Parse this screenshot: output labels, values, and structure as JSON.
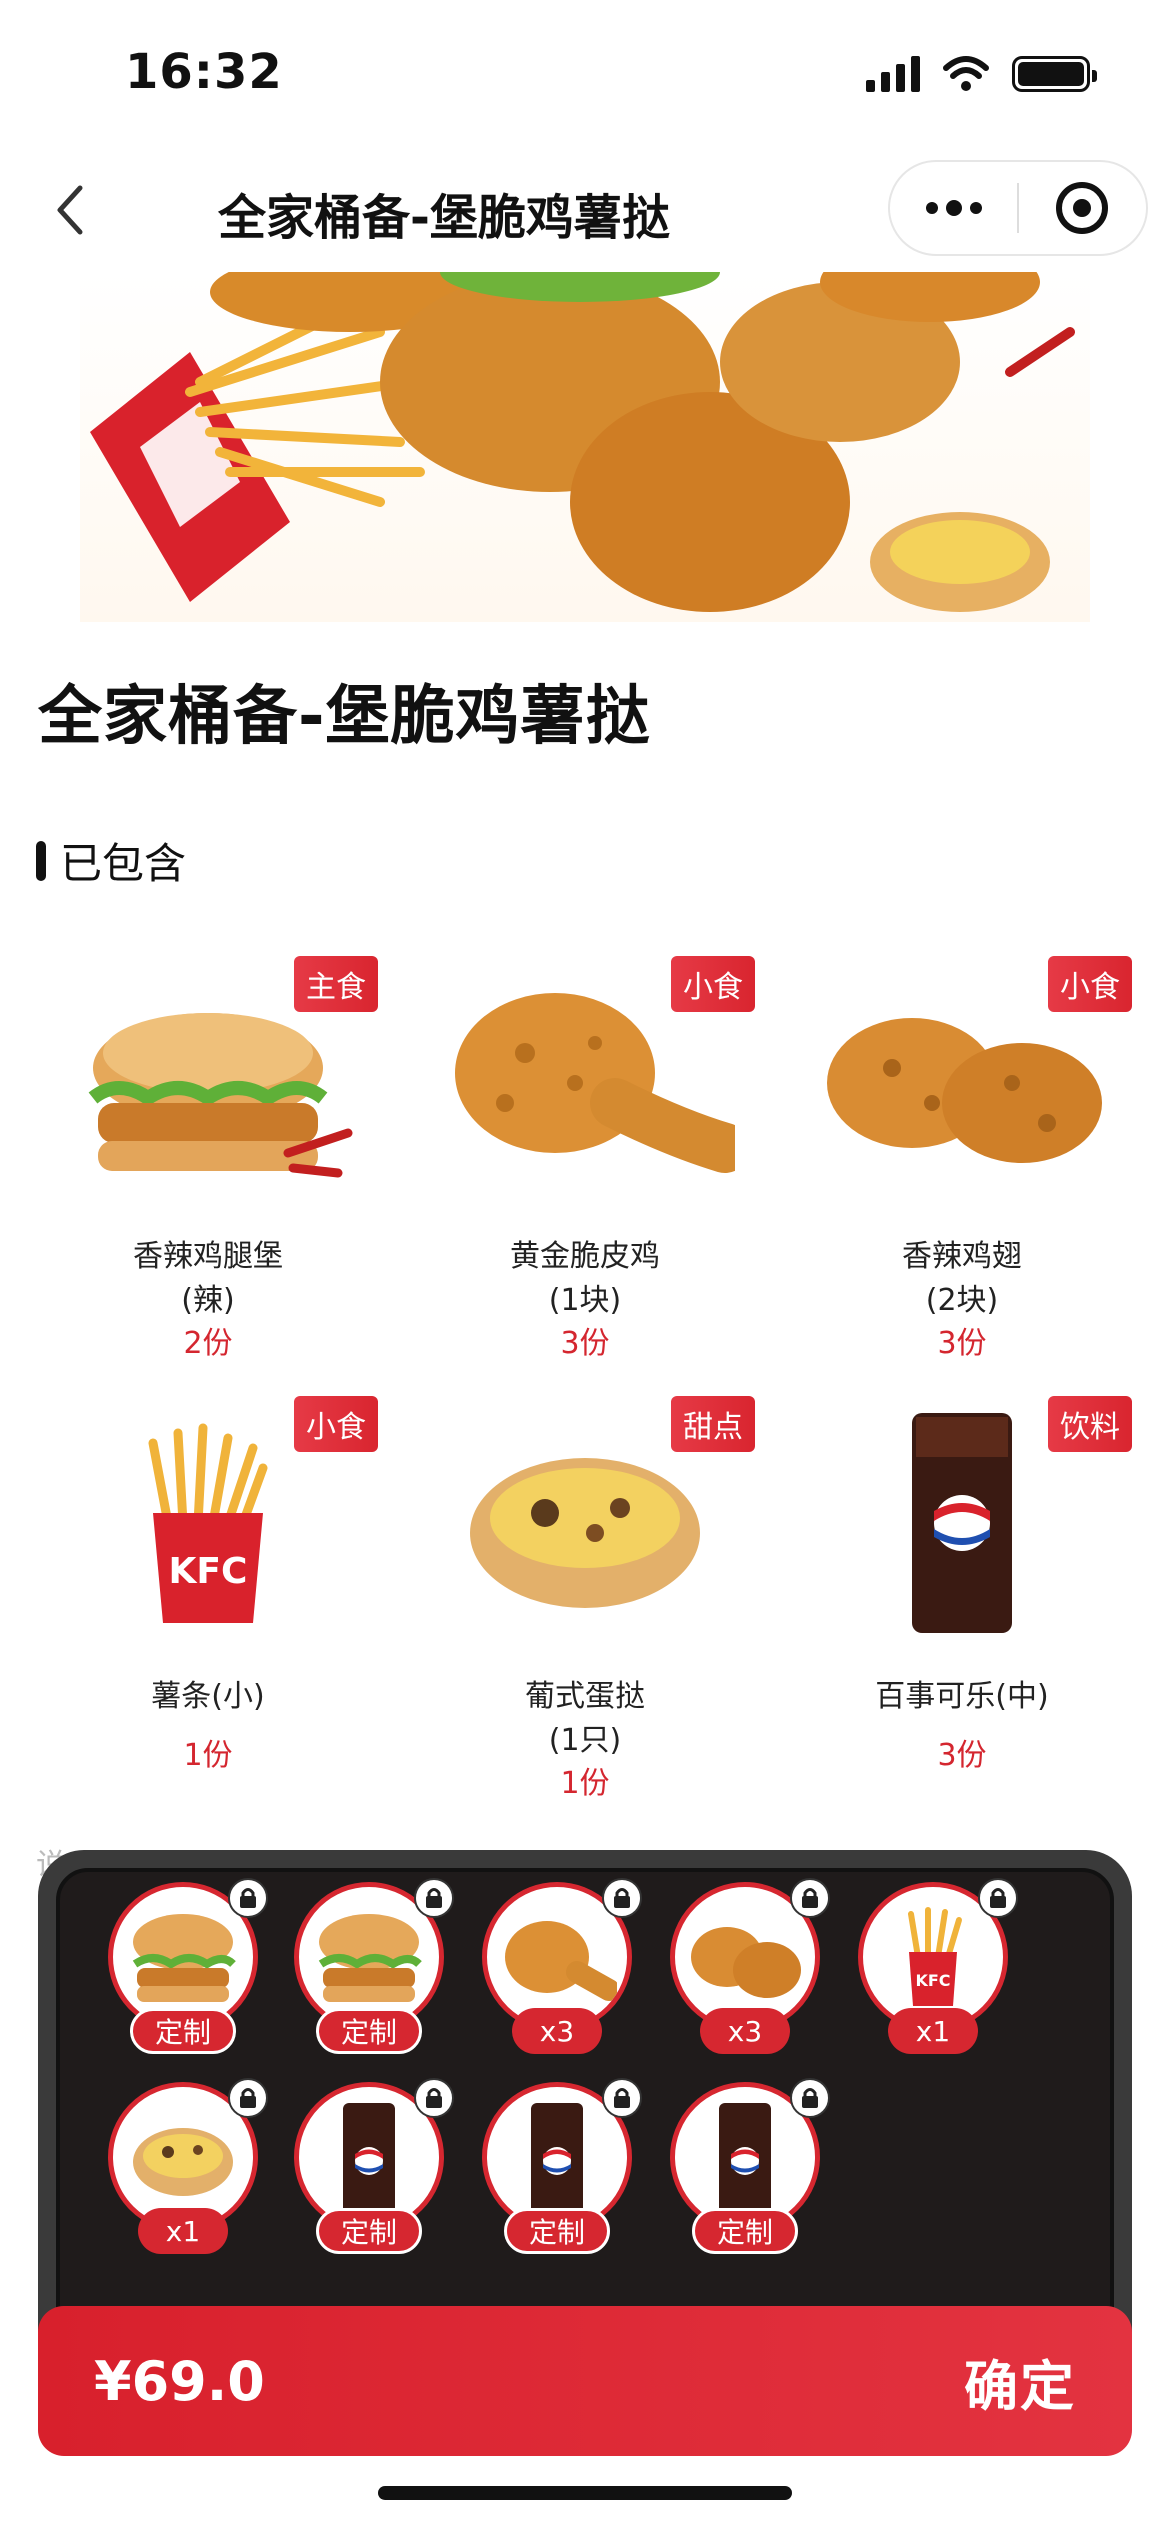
{
  "status_bar": {
    "time": "16:32"
  },
  "nav": {
    "title": "全家桶备-堡脆鸡薯挞"
  },
  "product": {
    "title": "全家桶备-堡脆鸡薯挞"
  },
  "section": {
    "label": "已包含"
  },
  "hint": "说",
  "items": [
    {
      "tag": "主食",
      "name_line1": "香辣鸡腿堡",
      "name_line2": "(辣)",
      "qty": "2份",
      "image": "burger"
    },
    {
      "tag": "小食",
      "name_line1": "黄金脆皮鸡",
      "name_line2": "(1块)",
      "qty": "3份",
      "image": "drumstick"
    },
    {
      "tag": "小食",
      "name_line1": "香辣鸡翅",
      "name_line2": "(2块)",
      "qty": "3份",
      "image": "wings"
    },
    {
      "tag": "小食",
      "name_line1": "薯条(小)",
      "name_line2": "",
      "qty": "1份",
      "image": "fries"
    },
    {
      "tag": "甜点",
      "name_line1": "葡式蛋挞",
      "name_line2": "(1只)",
      "qty": "1份",
      "image": "egg-tart"
    },
    {
      "tag": "饮料",
      "name_line1": "百事可乐(中)",
      "name_line2": "",
      "qty": "3份",
      "image": "pepsi"
    }
  ],
  "tray": {
    "chips": [
      {
        "label": "定制",
        "image": "burger"
      },
      {
        "label": "定制",
        "image": "burger"
      },
      {
        "label": "x3",
        "image": "drumstick"
      },
      {
        "label": "x3",
        "image": "wings"
      },
      {
        "label": "x1",
        "image": "fries"
      },
      {
        "label": "x1",
        "image": "egg-tart"
      },
      {
        "label": "定制",
        "image": "pepsi"
      },
      {
        "label": "定制",
        "image": "pepsi"
      },
      {
        "label": "定制",
        "image": "pepsi"
      }
    ]
  },
  "checkout": {
    "price": "¥69.0",
    "confirm": "确定"
  },
  "colors": {
    "accent": "#d62730",
    "tray_bg": "#1f1b1b"
  }
}
